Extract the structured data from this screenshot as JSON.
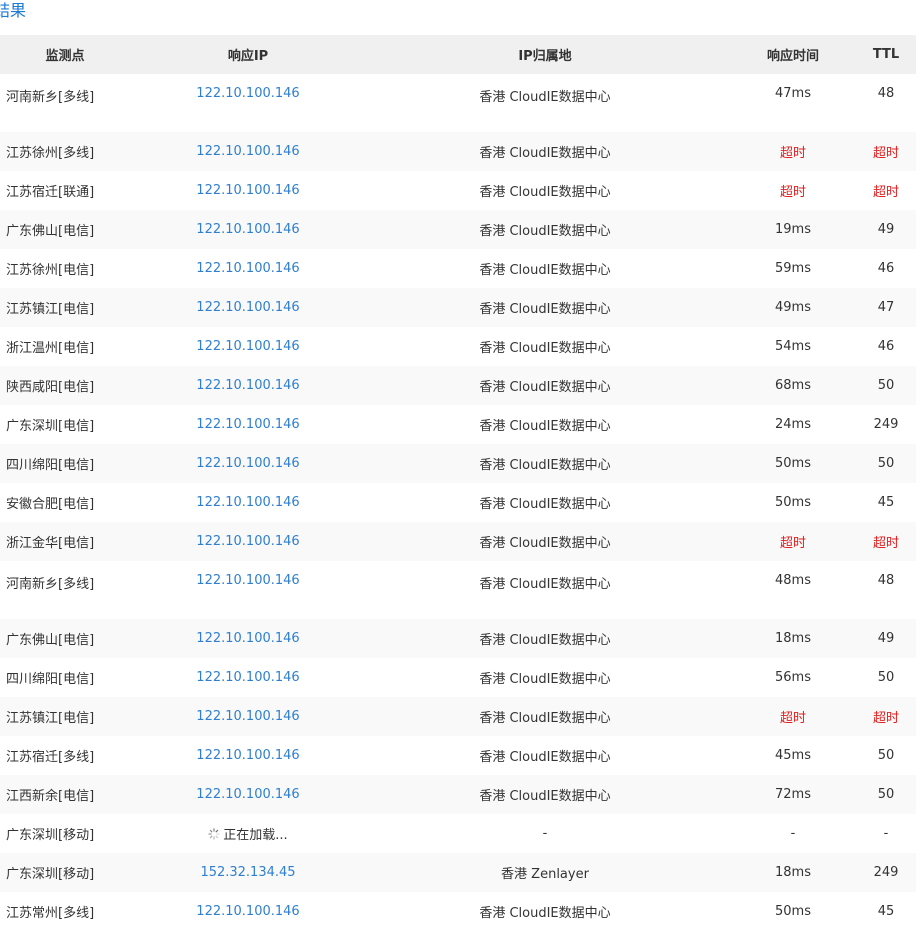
{
  "section": {
    "title": "结果"
  },
  "table": {
    "headers": {
      "node": "监测点",
      "ip": "响应IP",
      "location": "IP归属地",
      "time": "响应时间",
      "ttl": "TTL"
    },
    "rows": [
      {
        "node": "河南新乡[多线]",
        "ip": "122.10.100.146",
        "location": "香港 CloudIE数据中心",
        "time": "47ms",
        "ttl": "48"
      },
      {
        "node": "江苏徐州[多线]",
        "ip": "122.10.100.146",
        "location": "香港 CloudIE数据中心",
        "time": "超时",
        "ttl": "超时"
      },
      {
        "node": "江苏宿迁[联通]",
        "ip": "122.10.100.146",
        "location": "香港 CloudIE数据中心",
        "time": "超时",
        "ttl": "超时"
      },
      {
        "node": "广东佛山[电信]",
        "ip": "122.10.100.146",
        "location": "香港 CloudIE数据中心",
        "time": "19ms",
        "ttl": "49"
      },
      {
        "node": "江苏徐州[电信]",
        "ip": "122.10.100.146",
        "location": "香港 CloudIE数据中心",
        "time": "59ms",
        "ttl": "46"
      },
      {
        "node": "江苏镇江[电信]",
        "ip": "122.10.100.146",
        "location": "香港 CloudIE数据中心",
        "time": "49ms",
        "ttl": "47"
      },
      {
        "node": "浙江温州[电信]",
        "ip": "122.10.100.146",
        "location": "香港 CloudIE数据中心",
        "time": "54ms",
        "ttl": "46"
      },
      {
        "node": "陕西咸阳[电信]",
        "ip": "122.10.100.146",
        "location": "香港 CloudIE数据中心",
        "time": "68ms",
        "ttl": "50"
      },
      {
        "node": "广东深圳[电信]",
        "ip": "122.10.100.146",
        "location": "香港 CloudIE数据中心",
        "time": "24ms",
        "ttl": "249"
      },
      {
        "node": "四川绵阳[电信]",
        "ip": "122.10.100.146",
        "location": "香港 CloudIE数据中心",
        "time": "50ms",
        "ttl": "50"
      },
      {
        "node": "安徽合肥[电信]",
        "ip": "122.10.100.146",
        "location": "香港 CloudIE数据中心",
        "time": "50ms",
        "ttl": "45"
      },
      {
        "node": "浙江金华[电信]",
        "ip": "122.10.100.146",
        "location": "香港 CloudIE数据中心",
        "time": "超时",
        "ttl": "超时"
      },
      {
        "node": "河南新乡[多线]",
        "ip": "122.10.100.146",
        "location": "香港 CloudIE数据中心",
        "time": "48ms",
        "ttl": "48"
      },
      {
        "node": "广东佛山[电信]",
        "ip": "122.10.100.146",
        "location": "香港 CloudIE数据中心",
        "time": "18ms",
        "ttl": "49"
      },
      {
        "node": "四川绵阳[电信]",
        "ip": "122.10.100.146",
        "location": "香港 CloudIE数据中心",
        "time": "56ms",
        "ttl": "50"
      },
      {
        "node": "江苏镇江[电信]",
        "ip": "122.10.100.146",
        "location": "香港 CloudIE数据中心",
        "time": "超时",
        "ttl": "超时"
      },
      {
        "node": "江苏宿迁[多线]",
        "ip": "122.10.100.146",
        "location": "香港 CloudIE数据中心",
        "time": "45ms",
        "ttl": "50"
      },
      {
        "node": "江西新余[电信]",
        "ip": "122.10.100.146",
        "location": "香港 CloudIE数据中心",
        "time": "72ms",
        "ttl": "50"
      },
      {
        "node": "广东深圳[移动]",
        "ip": "正在加载...",
        "location": "-",
        "time": "-",
        "ttl": "-",
        "loading": true
      },
      {
        "node": "广东深圳[移动]",
        "ip": "152.32.134.45",
        "location": "香港 Zenlayer",
        "time": "18ms",
        "ttl": "249"
      },
      {
        "node": "江苏常州[多线]",
        "ip": "122.10.100.146",
        "location": "香港 CloudIE数据中心",
        "time": "50ms",
        "ttl": "45"
      }
    ]
  },
  "colors": {
    "title": "#1d7ad6",
    "link": "#2f7fd0",
    "timeout": "#e02020",
    "header_bg": "#f0f0f0",
    "stripe_bg": "#f9f9f9"
  },
  "icons": {
    "loading": "spinner-icon"
  }
}
